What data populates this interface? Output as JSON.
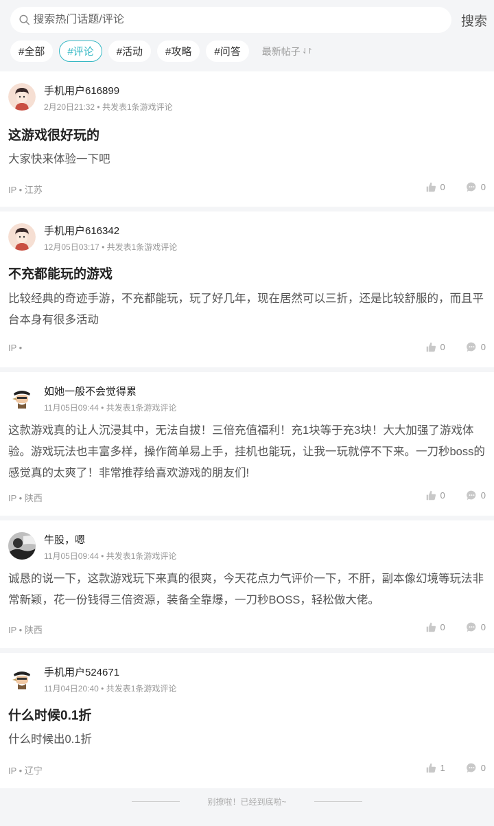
{
  "search": {
    "placeholder": "搜索热门话题/评论",
    "button": "搜索"
  },
  "tags": [
    "#全部",
    "#评论",
    "#活动",
    "#攻略",
    "#问答"
  ],
  "sort_label": "最新帖子",
  "posts": [
    {
      "user": "手机用户616899",
      "date": "2月20日21:32",
      "count": "共发表1条游戏评论",
      "title": "这游戏很好玩的",
      "content": "大家快来体验一下吧",
      "ip": "IP • 江苏",
      "likes": "0",
      "comments": "0"
    },
    {
      "user": "手机用户616342",
      "date": "12月05日03:17",
      "count": "共发表1条游戏评论",
      "title": "不充都能玩的游戏",
      "content": "比较经典的奇迹手游，不充都能玩，玩了好几年，现在居然可以三折，还是比较舒服的，而且平台本身有很多活动",
      "ip": "IP •",
      "likes": "0",
      "comments": "0"
    },
    {
      "user": "如她一般不会觉得累",
      "date": "11月05日09:44",
      "count": "共发表1条游戏评论",
      "title": "",
      "content": "这款游戏真的让人沉浸其中，无法自拔！三倍充值福利！充1块等于充3块！大大加强了游戏体验。游戏玩法也丰富多样，操作简单易上手，挂机也能玩，让我一玩就停不下来。一刀秒boss的感觉真的太爽了！非常推荐给喜欢游戏的朋友们!",
      "ip": "IP • 陕西",
      "likes": "0",
      "comments": "0"
    },
    {
      "user": "牛股，嗯",
      "date": "11月05日09:44",
      "count": "共发表1条游戏评论",
      "title": "",
      "content": "诚恳的说一下，这款游戏玩下来真的很爽，今天花点力气评价一下，不肝，副本像幻境等玩法非常新颖，花一份钱得三倍资源，装备全靠爆，一刀秒BOSS，轻松做大佬。",
      "ip": "IP • 陕西",
      "likes": "0",
      "comments": "0"
    },
    {
      "user": "手机用户524671",
      "date": "11月04日20:40",
      "count": "共发表1条游戏评论",
      "title": "什么时候0.1折",
      "content": "什么时候出0.1折",
      "ip": "IP • 辽宁",
      "likes": "1",
      "comments": "0"
    }
  ],
  "footer": "别撩啦！已经到底啦~",
  "colors": {
    "accent": "#35b8c4",
    "background": "#f4f5f7"
  }
}
